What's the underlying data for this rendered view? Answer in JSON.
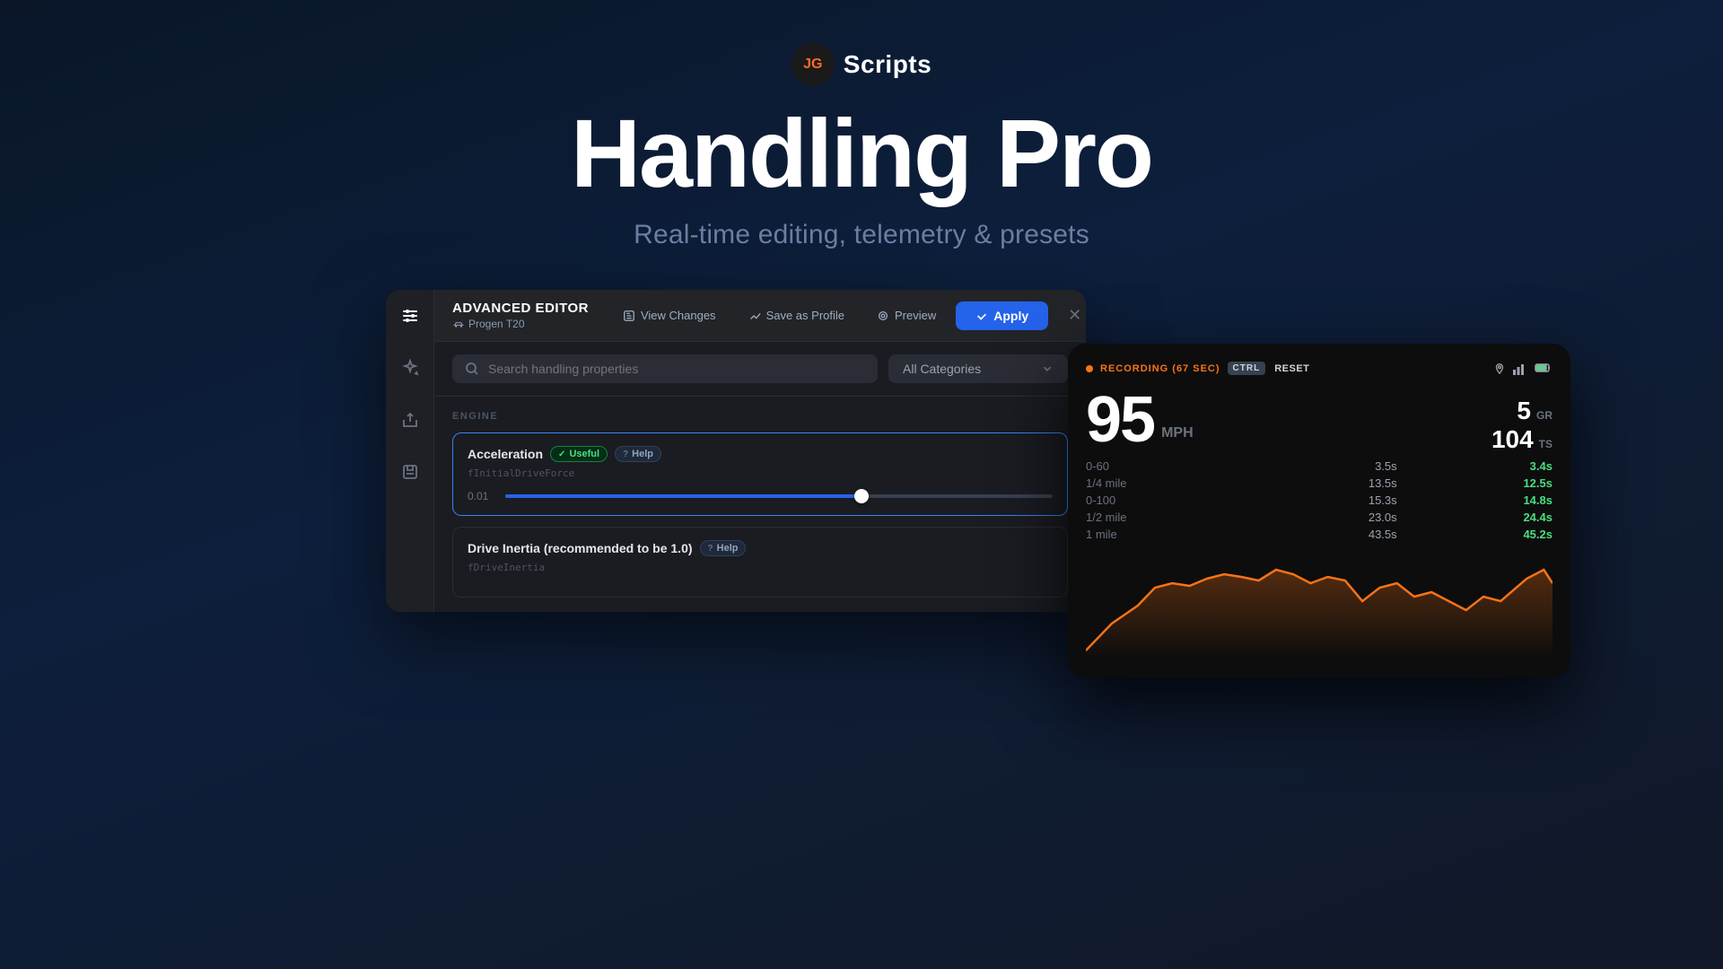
{
  "brand": {
    "logo_text": "JG",
    "name": "Scripts"
  },
  "hero": {
    "title": "Handling Pro",
    "subtitle": "Real-time editing, telemetry & presets"
  },
  "editor": {
    "title": "ADVANCED EDITOR",
    "vehicle": "Progen T20",
    "view_changes_label": "View Changes",
    "save_profile_label": "Save as Profile",
    "preview_label": "Preview",
    "apply_label": "Apply",
    "search_placeholder": "Search handling properties",
    "category_label": "All Categories",
    "section_engine": "ENGINE",
    "property1_name": "Acceleration",
    "property1_badge_useful": "Useful",
    "property1_badge_help": "Help",
    "property1_code": "fInitialDriveForce",
    "property1_slider_min": "0.01",
    "property2_name": "Drive Inertia (recommended to be 1.0)",
    "property2_badge_help": "Help",
    "property2_code": "fDriveInertia"
  },
  "telemetry": {
    "recording_label": "RECORDING (67 SEC)",
    "ctrl_label": "CTRL",
    "reset_label": "RESET",
    "speed_value": "95",
    "speed_unit": "MPH",
    "gear_value": "5",
    "gear_label": "GR",
    "ts_value": "104",
    "ts_label": "TS",
    "stats": [
      {
        "label": "0-60",
        "base": "3.5s",
        "current": "3.4s"
      },
      {
        "label": "1/4 mile",
        "base": "13.5s",
        "current": "12.5s"
      },
      {
        "label": "0-100",
        "base": "15.3s",
        "current": "14.8s"
      },
      {
        "label": "1/2 mile",
        "base": "23.0s",
        "current": "24.4s"
      },
      {
        "label": "1 mile",
        "base": "43.5s",
        "current": "45.2s"
      }
    ]
  },
  "colors": {
    "accent_blue": "#2563eb",
    "accent_orange": "#f97316",
    "accent_green": "#4ade80",
    "bg_dark": "#0d0d0d",
    "bg_panel": "#1a1c22"
  }
}
